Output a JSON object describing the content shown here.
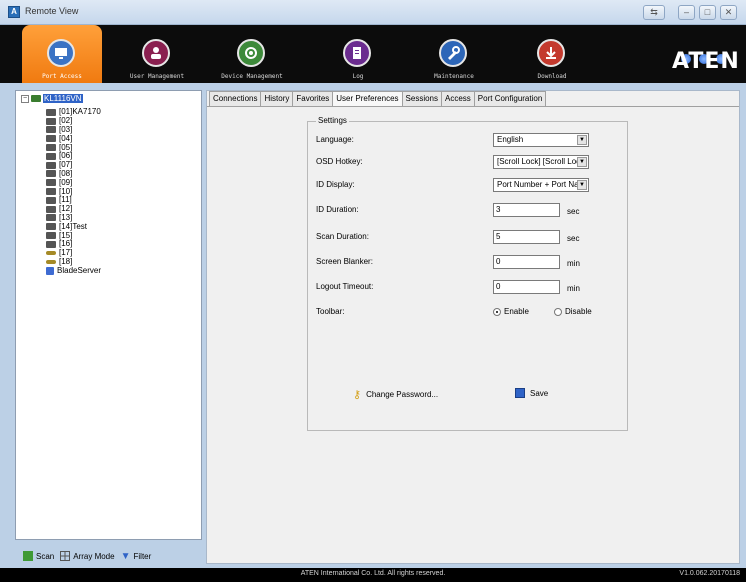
{
  "window": {
    "title": "Remote View"
  },
  "toolbar": {
    "items": [
      {
        "label": "Port Access",
        "icon": "port-access-icon",
        "active": true
      },
      {
        "label": "User Management",
        "icon": "user-management-icon"
      },
      {
        "label": "Device Management",
        "icon": "device-management-icon"
      },
      {
        "label": "Log",
        "icon": "log-icon"
      },
      {
        "label": "Maintenance",
        "icon": "maintenance-icon"
      },
      {
        "label": "Download",
        "icon": "download-icon"
      }
    ],
    "logo": "ATEN"
  },
  "tree": {
    "root": "KL1116VN",
    "items": [
      "[01]KA7170",
      "[02]",
      "[03]",
      "[04]",
      "[05]",
      "[06]",
      "[07]",
      "[08]",
      "[09]",
      "[10]",
      "[11]",
      "[12]",
      "[13]",
      "[14]Test",
      "[15]",
      "[16]",
      "[17]",
      "[18]",
      "BladeServer"
    ]
  },
  "bottom": {
    "scan": "Scan",
    "array_mode": "Array Mode",
    "filter": "Filter"
  },
  "tabs": [
    "Connections",
    "History",
    "Favorites",
    "User Preferences",
    "Sessions",
    "Access",
    "Port Configuration"
  ],
  "settings": {
    "legend": "Settings",
    "language": {
      "label": "Language:",
      "value": "English"
    },
    "osd_hotkey": {
      "label": "OSD Hotkey:",
      "value": "[Scroll Lock] [Scroll Loc"
    },
    "id_display": {
      "label": "ID Display:",
      "value": "Port Number + Port Nam"
    },
    "id_duration": {
      "label": "ID Duration:",
      "value": "3",
      "unit": "sec"
    },
    "scan_duration": {
      "label": "Scan Duration:",
      "value": "5",
      "unit": "sec"
    },
    "screen_blanker": {
      "label": "Screen Blanker:",
      "value": "0",
      "unit": "min"
    },
    "logout_timeout": {
      "label": "Logout Timeout:",
      "value": "0",
      "unit": "min"
    },
    "toolbar": {
      "label": "Toolbar:",
      "enable": "Enable",
      "disable": "Disable",
      "selected": "Enable"
    },
    "change_password": "Change Password...",
    "save": "Save"
  },
  "status": {
    "copyright": "ATEN International Co. Ltd. All rights reserved.",
    "version": "V1.0.062.20170118"
  }
}
